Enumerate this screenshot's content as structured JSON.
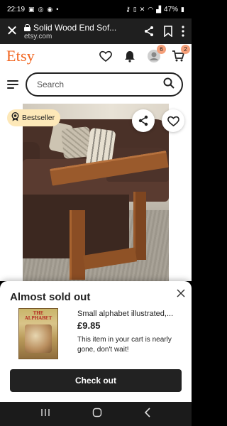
{
  "status_bar": {
    "time": "22:19",
    "battery": "47%"
  },
  "browser": {
    "page_title": "Solid Wood End Sof...",
    "domain": "etsy.com"
  },
  "header": {
    "logo": "Etsy",
    "notifications_badge": "6",
    "cart_badge": "2"
  },
  "search": {
    "placeholder": "Search"
  },
  "listing": {
    "badge": "Bestseller"
  },
  "sheet": {
    "title": "Almost sold out",
    "item_name": "Small alphabet illustrated,...",
    "price": "£9.85",
    "note": "This item in your cart is nearly gone, don't wait!",
    "checkout_label": "Check out",
    "book_cover_text": "THE ALPHABET"
  },
  "colors": {
    "brand": "#f1641e",
    "bestseller_bg": "#fde8b8",
    "badge_bg": "#f5a07a",
    "checkout_bg": "#222222"
  }
}
